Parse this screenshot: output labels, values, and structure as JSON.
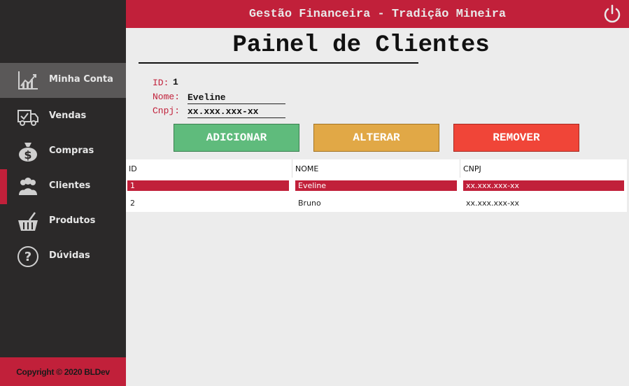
{
  "header": {
    "title": "Gestão Financeira - Tradição Mineira"
  },
  "sidebar": {
    "items": [
      {
        "label": "Minha Conta",
        "icon": "chart-icon"
      },
      {
        "label": "Vendas",
        "icon": "delivery-truck-icon"
      },
      {
        "label": "Compras",
        "icon": "money-bag-icon"
      },
      {
        "label": "Clientes",
        "icon": "users-icon"
      },
      {
        "label": "Produtos",
        "icon": "basket-icon"
      },
      {
        "label": "Dúvidas",
        "icon": "question-icon"
      }
    ],
    "copyright": "Copyright © 2020 BLDev"
  },
  "main": {
    "title": "Painel de Clientes",
    "form": {
      "id_label": "ID:",
      "id_value": "1",
      "nome_label": "Nome:",
      "nome_value": "Eveline",
      "cnpj_label": "Cnpj:",
      "cnpj_value": "xx.xxx.xxx-xx"
    },
    "buttons": {
      "add": "ADICIONAR",
      "alter": "ALTERAR",
      "remove": "REMOVER"
    },
    "table": {
      "headers": [
        "ID",
        "NOME",
        "CNPJ"
      ],
      "rows": [
        [
          "1",
          "Eveline",
          "xx.xxx.xxx-xx"
        ],
        [
          "2",
          "Bruno",
          "xx.xxx.xxx-xx"
        ]
      ]
    }
  },
  "colors": {
    "accent": "#c1203a",
    "sidebar": "#2b2929",
    "add": "#5fbb7c",
    "alter": "#e1a846",
    "remove": "#f04538"
  }
}
